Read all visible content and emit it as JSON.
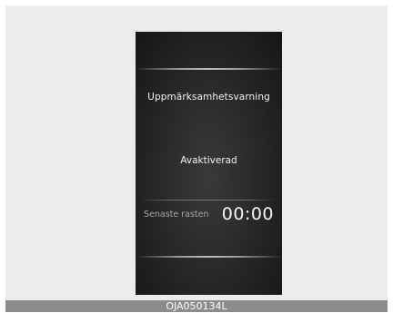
{
  "display": {
    "title": "Uppmärksamhetsvarning",
    "status": "Avaktiverad",
    "last_break_label": "Senaste rasten",
    "last_break_time": "00:00"
  },
  "caption": {
    "code": "OJA050134L"
  }
}
